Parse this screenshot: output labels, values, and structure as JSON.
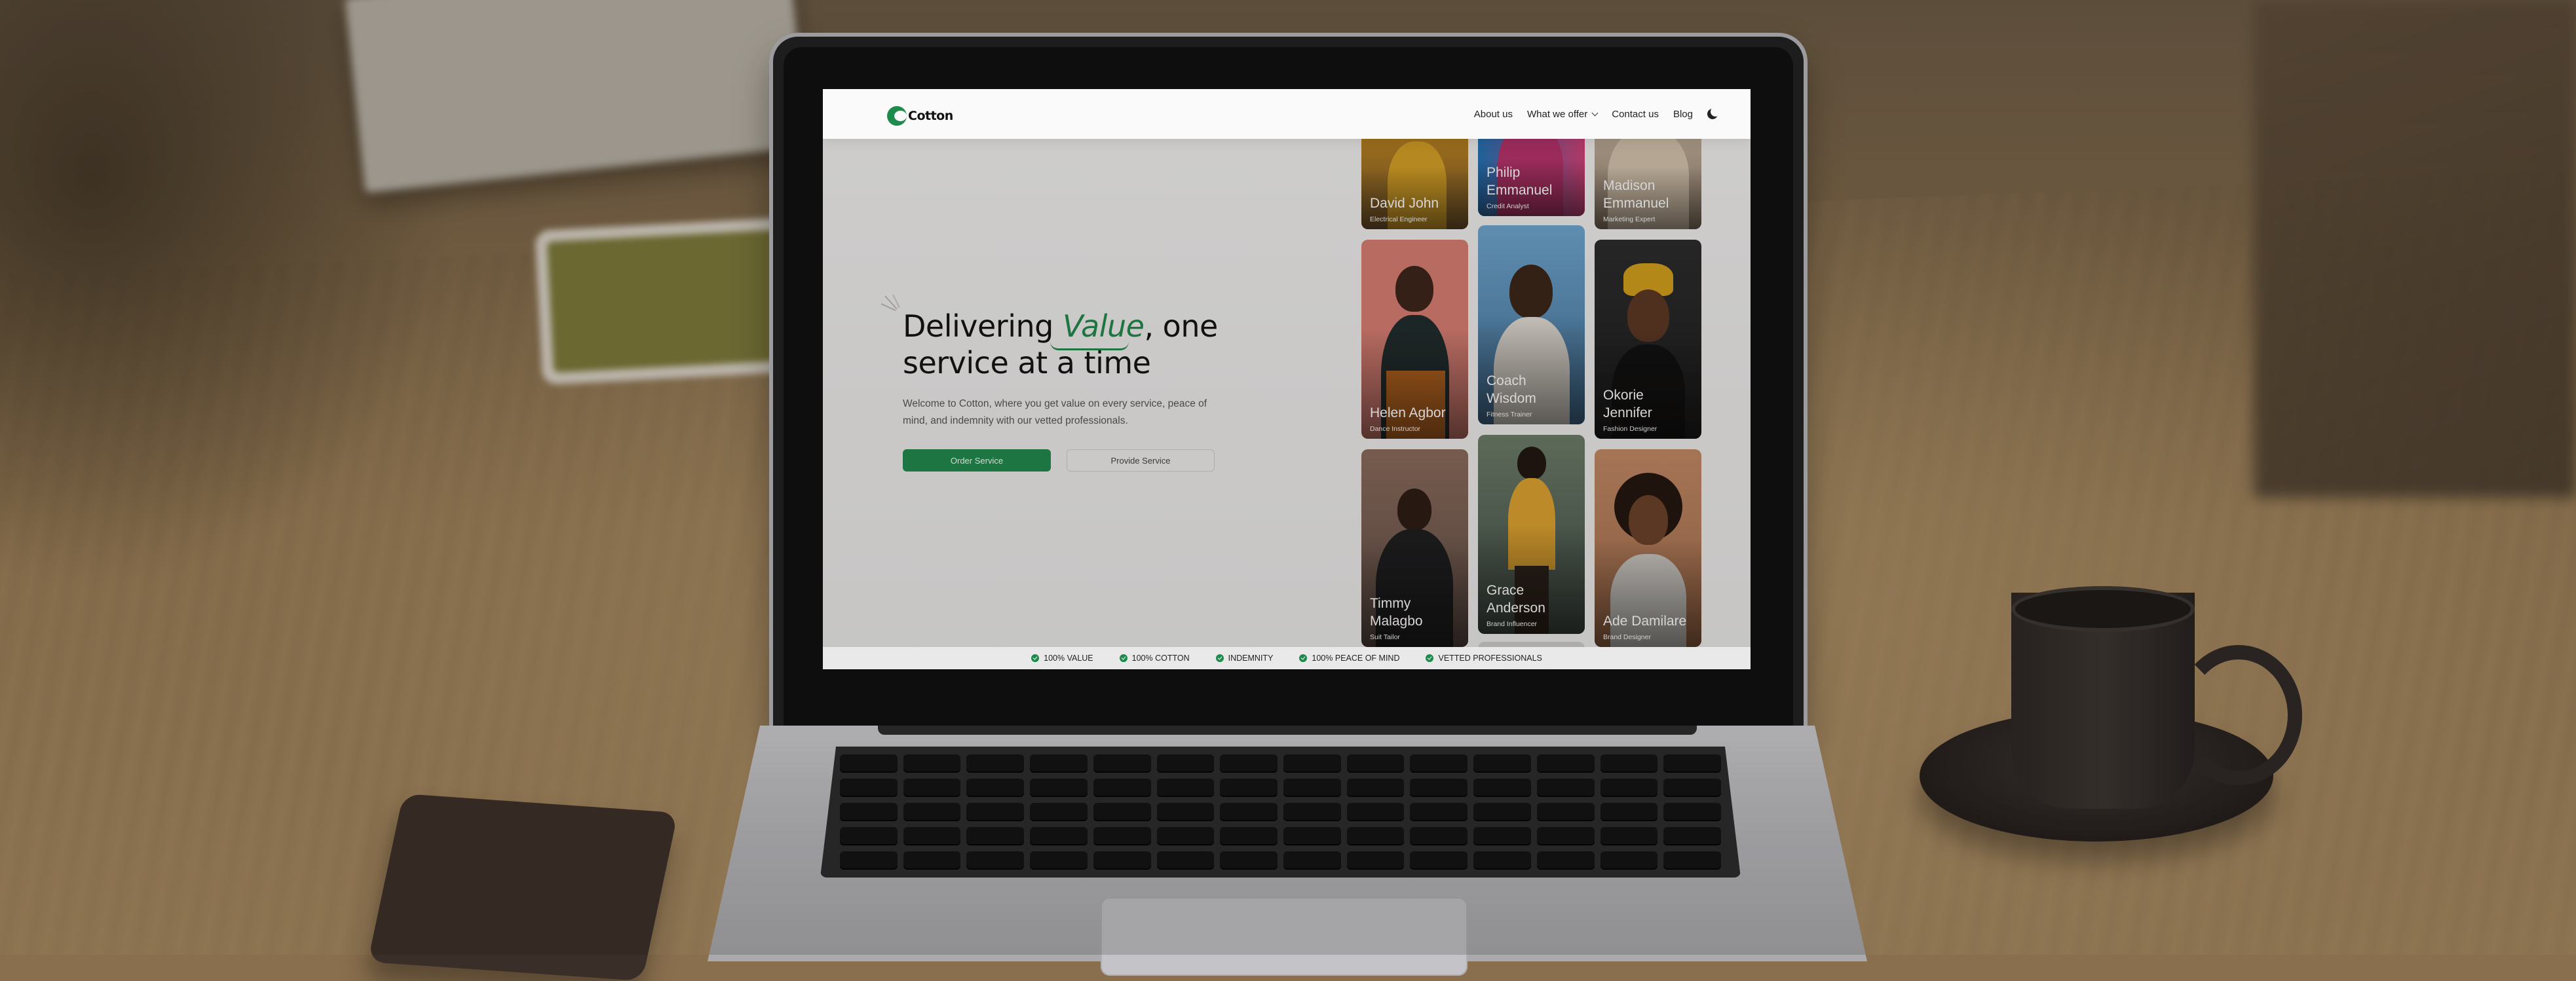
{
  "site": {
    "logo_text": "Cotton",
    "nav": {
      "about": "About us",
      "offer": "What we offer",
      "contact": "Contact us",
      "blog": "Blog"
    },
    "hero": {
      "title_before": "Delivering ",
      "title_accent": "Value",
      "title_after": ", one service at a time",
      "description": "Welcome to Cotton, where you get value on every service, peace of mind, and indemnity with our vetted professionals.",
      "primary_button": "Order Service",
      "secondary_button": "Provide Service"
    },
    "people": [
      {
        "name": "David John",
        "role": "Electrical Engineer"
      },
      {
        "name": "Philip Emmanuel",
        "role": "Credit Analyst"
      },
      {
        "name": "Madison Emmanuel",
        "role": "Marketing Expert"
      },
      {
        "name": "Helen Agbor",
        "role": "Dance Instructor"
      },
      {
        "name": "Coach Wisdom",
        "role": "Fitness Trainer"
      },
      {
        "name": "Okorie Jennifer",
        "role": "Fashion Designer"
      },
      {
        "name": "Timmy Malagbo",
        "role": "Suit Tailor"
      },
      {
        "name": "Grace Anderson",
        "role": "Brand Influencer"
      },
      {
        "name": "Ade Damilare",
        "role": "Brand Designer"
      }
    ],
    "ticker": [
      "100% VALUE",
      "100% COTTON",
      "INDEMNITY",
      "100% PEACE OF MIND",
      "VETTED PROFESSIONALS"
    ],
    "colors": {
      "accent": "#1e8a4c",
      "text": "#111111",
      "muted": "#555555"
    }
  }
}
